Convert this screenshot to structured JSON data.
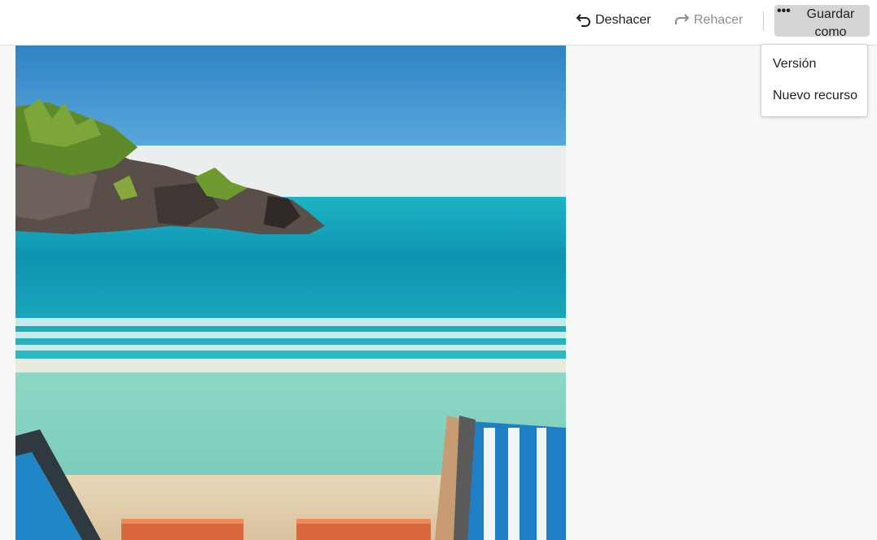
{
  "toolbar": {
    "undo_label": "Deshacer",
    "redo_label": "Rehacer",
    "save_as_label": "Guardar como",
    "more_icon": "more-horizontal-icon",
    "undo_icon": "undo-icon",
    "redo_icon": "redo-icon"
  },
  "save_menu": {
    "items": [
      {
        "label": "Versión"
      },
      {
        "label": "Nuevo recurso"
      }
    ]
  },
  "canvas": {
    "image_subject": "beach scene with rocky islet, turquoise sea and two beach chairs"
  },
  "colors": {
    "topbar_bg": "#ffffff",
    "page_bg": "#f8f8f8",
    "save_button_bg": "#d4d4d4",
    "disabled_text": "#8e8e8e"
  }
}
